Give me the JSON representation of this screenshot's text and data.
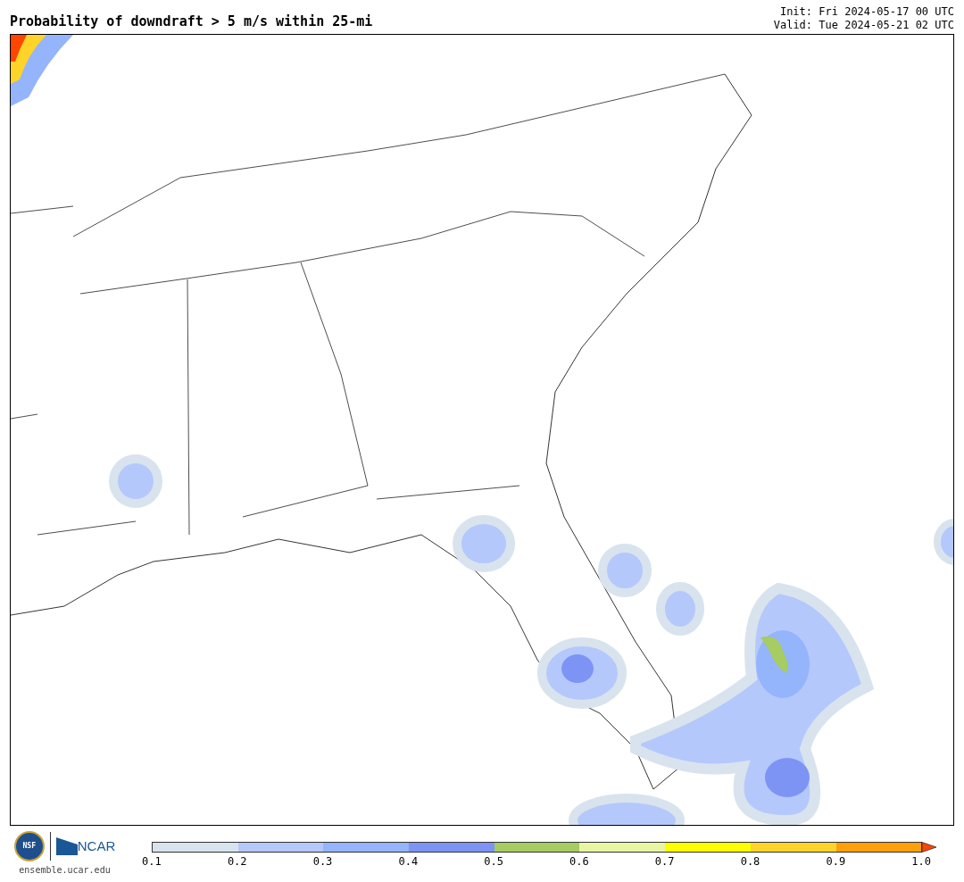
{
  "title": "Probability of downdraft > 5 m/s within 25-mi",
  "init": "Init: Fri 2024-05-17 00 UTC",
  "valid": "Valid: Tue 2024-05-21 02 UTC",
  "logos": {
    "nsf": "NSF",
    "ncar": "NCAR",
    "url": "ensemble.ucar.edu"
  },
  "colorbar": {
    "segments": [
      {
        "color": "#d8e3ee"
      },
      {
        "color": "#b4c8fc"
      },
      {
        "color": "#94b4fc"
      },
      {
        "color": "#7d94f5"
      },
      {
        "color": "#a6cc62"
      },
      {
        "color": "#e8f5a3"
      },
      {
        "color": "#ffff00"
      },
      {
        "color": "#ffd42a"
      },
      {
        "color": "#ff9f0a"
      },
      {
        "kind": "arrow",
        "color": "#ff4500"
      }
    ],
    "ticks": [
      "0.1",
      "0.2",
      "0.3",
      "0.4",
      "0.5",
      "0.6",
      "0.7",
      "0.8",
      "0.9",
      "1.0"
    ]
  }
}
